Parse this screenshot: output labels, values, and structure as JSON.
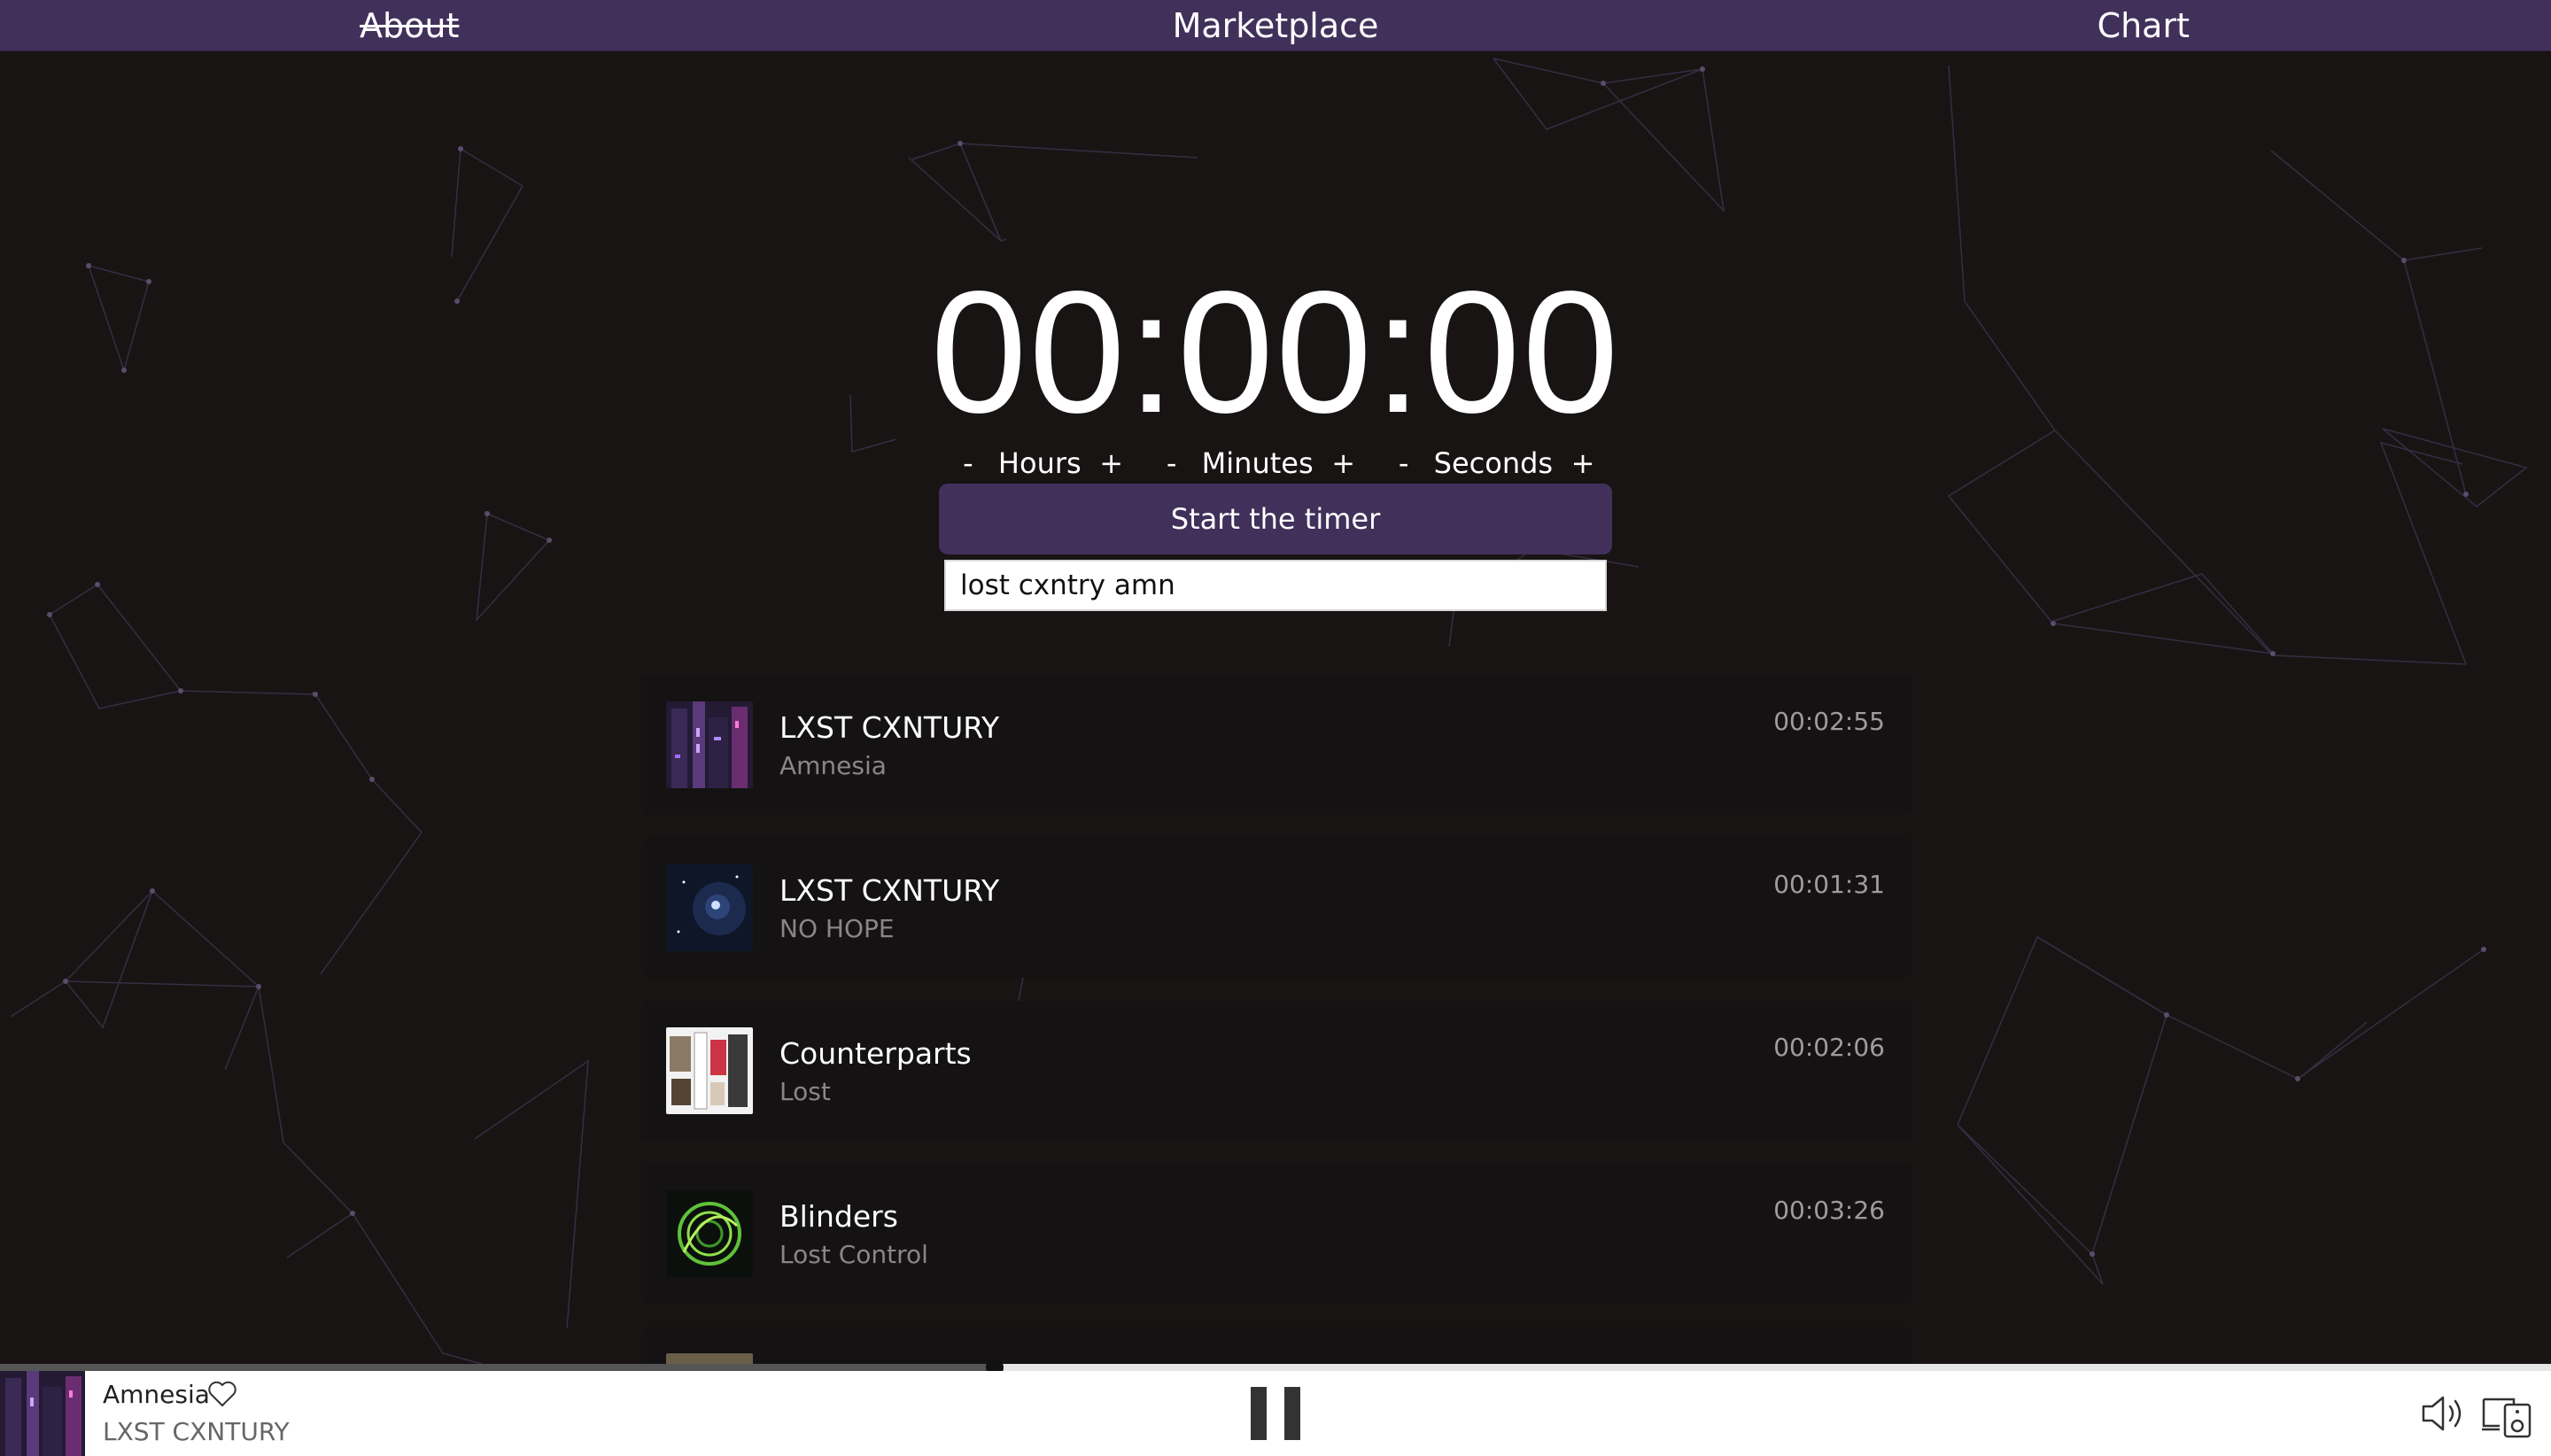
{
  "nav": {
    "about": "About",
    "marketplace": "Marketplace",
    "chart": "Chart"
  },
  "timer": {
    "display": "00:00:00",
    "minus": "-",
    "plus": "+",
    "hours_label": "Hours",
    "minutes_label": "Minutes",
    "seconds_label": "Seconds",
    "start_label": "Start the timer"
  },
  "search": {
    "value": "lost cxntry amn"
  },
  "tracks": [
    {
      "artist": "LXST CXNTURY",
      "title": "Amnesia",
      "duration": "00:02:55",
      "art": "cyber-city-art"
    },
    {
      "artist": "LXST CXNTURY",
      "title": "NO HOPE",
      "duration": "00:01:31",
      "art": "space-art"
    },
    {
      "artist": "Counterparts",
      "title": "Lost",
      "duration": "00:02:06",
      "art": "collage-art"
    },
    {
      "artist": "Blinders",
      "title": "Lost Control",
      "duration": "00:03:26",
      "art": "green-spiral-art"
    }
  ],
  "player": {
    "title": "Amnesia",
    "artist": "LXST CXNTURY",
    "progress": 0.39,
    "state": "playing"
  },
  "icons": {
    "like": "heart-icon",
    "pause": "pause-icon",
    "volume": "speaker-icon",
    "devices": "devices-icon"
  },
  "colors": {
    "accent": "#41305a",
    "background": "#181414",
    "card": "#141212"
  }
}
